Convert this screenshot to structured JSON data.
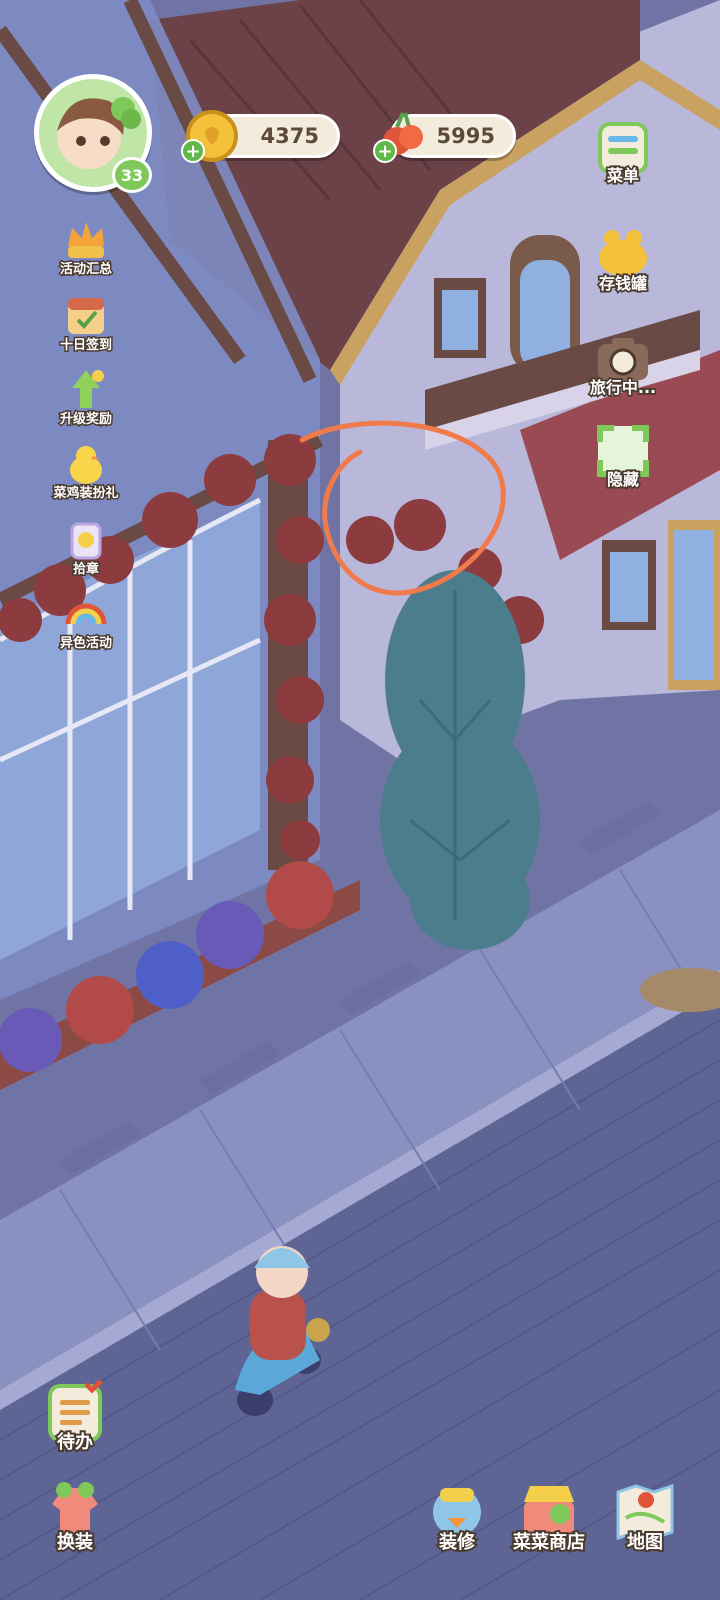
{
  "player": {
    "level": "33",
    "avatar_icon": "player-avatar-icon"
  },
  "currencies": {
    "coins": {
      "value": "4375",
      "icon": "gold-coin-icon"
    },
    "veggies": {
      "value": "5995",
      "icon": "radish-icon"
    }
  },
  "events": [
    {
      "label": "活动汇总",
      "icon": "event-summary-icon"
    },
    {
      "label": "十日签到",
      "icon": "ten-day-checkin-icon"
    },
    {
      "label": "升级奖励",
      "icon": "level-up-reward-icon"
    },
    {
      "label": "菜鸡装扮礼",
      "icon": "chick-outfit-gift-icon"
    },
    {
      "label": "拾章",
      "icon": "badge-collect-icon"
    },
    {
      "label": "异色活动",
      "icon": "rainbow-event-icon"
    }
  ],
  "right_menu": [
    {
      "label": "菜单",
      "icon": "menu-icon"
    },
    {
      "label": "存钱罐",
      "icon": "piggy-bank-icon"
    },
    {
      "label": "旅行中...",
      "icon": "camera-travel-icon"
    },
    {
      "label": "隐藏",
      "icon": "hide-ui-icon"
    }
  ],
  "bottom_left": [
    {
      "label": "待办",
      "icon": "todo-clipboard-icon"
    },
    {
      "label": "换装",
      "icon": "wardrobe-icon"
    }
  ],
  "bottom_right": [
    {
      "label": "装修",
      "icon": "decorate-icon"
    },
    {
      "label": "菜菜商店",
      "icon": "shop-icon"
    },
    {
      "label": "地图",
      "icon": "map-icon"
    }
  ],
  "colors": {
    "annotation_circle": "#f07a4a",
    "coin": "#f4c13a",
    "leaf_red": "#8c3b3f"
  }
}
